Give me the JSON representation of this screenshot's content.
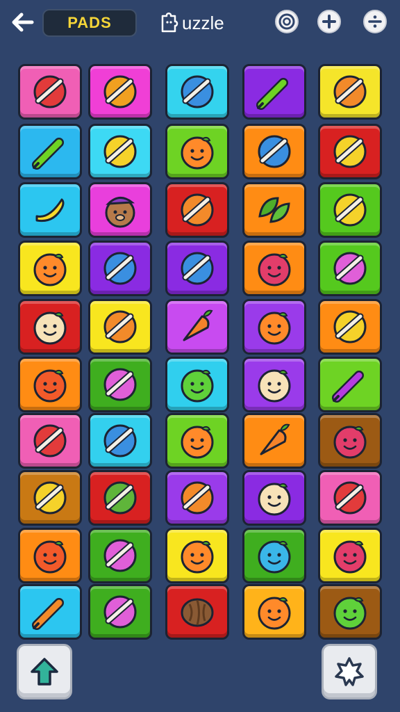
{
  "header": {
    "title_badge": "PADS",
    "game_title": "uzzle",
    "icons": [
      "back-arrow-icon",
      "puzzle-piece-icon",
      "target-icon",
      "plus-icon",
      "divide-icon"
    ]
  },
  "board": {
    "rows": 10,
    "cols": 5,
    "tiles": [
      [
        "#f05fb5",
        "pen-on-ball-icon"
      ],
      [
        "#f03fd6",
        "fruit-slice-icon"
      ],
      [
        "#34d3ee",
        "star-ball-icon"
      ],
      [
        "#8a2be2",
        "rolling-pin-icon"
      ],
      [
        "#f5e52a",
        "planet-icon"
      ],
      [
        "#2cb8ef",
        "green-pen-icon"
      ],
      [
        "#3dd9f4",
        "banana-ball-icon"
      ],
      [
        "#6ed324",
        "orange-face-icon"
      ],
      [
        "#ff8c14",
        "ring-ball-icon"
      ],
      [
        "#d82121",
        "crayon-ball-icon"
      ],
      [
        "#2cc6f0",
        "banana-icon"
      ],
      [
        "#e93fdc",
        "bear-cap-icon"
      ],
      [
        "#d82121",
        "brush-ball-icon"
      ],
      [
        "#ff8c14",
        "leaves-icon"
      ],
      [
        "#55c91e",
        "yellow-pen-ball-icon"
      ],
      [
        "#f8e61f",
        "orange-face-icon"
      ],
      [
        "#8a2be2",
        "blue-ball-icon"
      ],
      [
        "#8a2be2",
        "dart-ball-icon"
      ],
      [
        "#ff8c14",
        "berry-face-icon"
      ],
      [
        "#55c91e",
        "pink-brush-ball-icon"
      ],
      [
        "#d82121",
        "peach-face-icon"
      ],
      [
        "#f8e61f",
        "brush-ball-icon"
      ],
      [
        "#c84bf0",
        "carrot-icon"
      ],
      [
        "#9a3bea",
        "orange-face-icon"
      ],
      [
        "#ff8c14",
        "crayon-ball-icon"
      ],
      [
        "#ff8c14",
        "tomato-face-icon"
      ],
      [
        "#3fae1f",
        "purple-pen-ball-icon"
      ],
      [
        "#30cfee",
        "green-face-icon"
      ],
      [
        "#9a3bea",
        "cat-face-icon"
      ],
      [
        "#6ed324",
        "marker-icon"
      ],
      [
        "#f05fb5",
        "red-pen-ball-icon"
      ],
      [
        "#33d0ee",
        "ring-ball-icon"
      ],
      [
        "#6ed324",
        "orange-face-icon"
      ],
      [
        "#ff8c14",
        "carrot-icon"
      ],
      [
        "#9c5a14",
        "berry-face-icon"
      ],
      [
        "#c97914",
        "yellow-stripe-ball-icon"
      ],
      [
        "#d82121",
        "leaf-ball-icon"
      ],
      [
        "#9a3bea",
        "brush-ball-icon"
      ],
      [
        "#8a2be2",
        "cream-face-icon"
      ],
      [
        "#f05fb5",
        "red-pen-ball-icon"
      ],
      [
        "#ff8c14",
        "tomato-face-icon"
      ],
      [
        "#3fae1f",
        "pink-pen-ball-icon"
      ],
      [
        "#f8e61f",
        "orange-face-icon"
      ],
      [
        "#3fae1f",
        "blue-face-icon"
      ],
      [
        "#f8e61f",
        "berry-face-icon"
      ],
      [
        "#2cc6f0",
        "orange-pen-icon"
      ],
      [
        "#3fae1f",
        "pink-pen-ball-icon"
      ],
      [
        "#d82121",
        "walnut-icon"
      ],
      [
        "#ffb31a",
        "orange-face-icon"
      ],
      [
        "#9c5a14",
        "green-face-icon"
      ]
    ]
  },
  "footer": {
    "left_icon": "up-arrow-icon",
    "right_icon": "star-gear-icon"
  }
}
